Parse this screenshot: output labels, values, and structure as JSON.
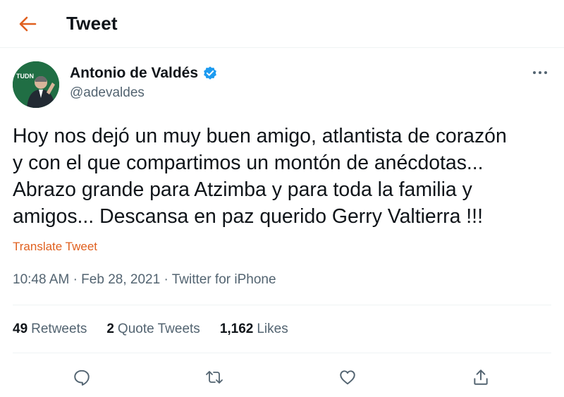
{
  "header": {
    "title": "Tweet",
    "back_icon": "arrow-left-icon"
  },
  "author": {
    "name": "Antonio de Valdés",
    "handle": "@adevaldes",
    "verified": true,
    "avatar_text": "TUDN"
  },
  "tweet": {
    "text": "Hoy nos dejó un muy buen amigo, atlantista de corazón\ny con el que compartimos un montón de anécdotas...\nAbrazo grande para Atzimba y para toda la familia y\namigos... Descansa en paz querido Gerry Valtierra !!!",
    "translate_label": "Translate Tweet",
    "time": "10:48 AM",
    "date": "Feb 28, 2021",
    "source": "Twitter for iPhone",
    "separator": "·"
  },
  "stats": {
    "retweets_count": "49",
    "retweets_label": "Retweets",
    "quotes_count": "2",
    "quotes_label": "Quote Tweets",
    "likes_count": "1,162",
    "likes_label": "Likes"
  },
  "colors": {
    "accent": "#e0601f",
    "verified": "#1d9bf0",
    "secondary_text": "#536471",
    "border": "#eff3f4"
  }
}
